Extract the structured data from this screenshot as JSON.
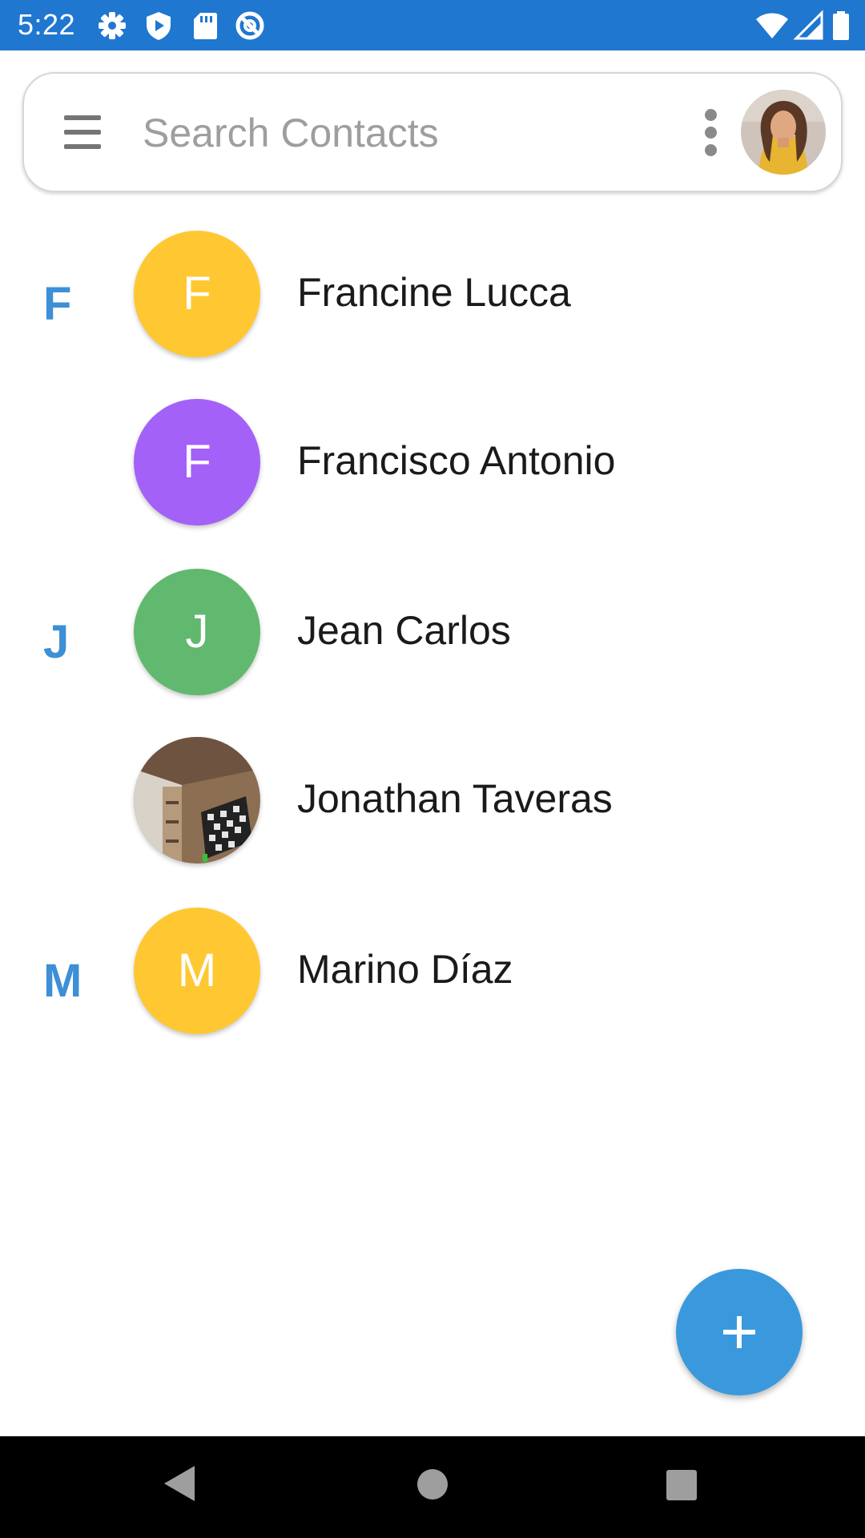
{
  "status_bar": {
    "time": "5:22",
    "left_icons": [
      "gear-icon",
      "play-protect-icon",
      "sd-card-icon",
      "at-sign-icon"
    ],
    "right_icons": [
      "wifi-icon",
      "cell-signal-icon",
      "battery-icon"
    ],
    "background_color": "#1f77d0"
  },
  "search": {
    "placeholder": "Search Contacts",
    "value": ""
  },
  "contacts": [
    {
      "section": "F",
      "initial": "F",
      "name": "Francine Lucca",
      "avatar_color": "#ffc832",
      "photo": false
    },
    {
      "section": "",
      "initial": "F",
      "name": "Francisco Antonio",
      "avatar_color": "#a461f8",
      "photo": false
    },
    {
      "section": "J",
      "initial": "J",
      "name": "Jean Carlos",
      "avatar_color": "#60b96e",
      "photo": false
    },
    {
      "section": "",
      "initial": "",
      "name": "Jonathan Taveras",
      "avatar_color": "#8c6e52",
      "photo": true
    },
    {
      "section": "M",
      "initial": "M",
      "name": "Marino Díaz",
      "avatar_color": "#ffc832",
      "photo": false
    }
  ],
  "colors": {
    "accent": "#3a99dd",
    "section_letter": "#3d8fd6"
  }
}
